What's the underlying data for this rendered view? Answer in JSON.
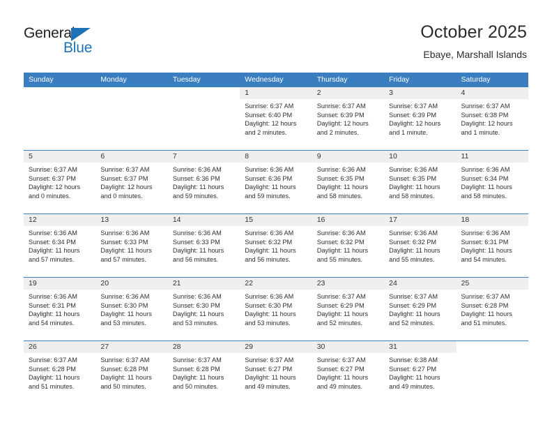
{
  "brand": {
    "name_top": "General",
    "name_bottom": "Blue",
    "accent_color": "#1f71b8"
  },
  "header": {
    "title": "October 2025",
    "subtitle": "Ebaye, Marshall Islands"
  },
  "theme": {
    "header_row_bg": "#3a7ebf",
    "day_band_bg": "#efefef",
    "grid_line": "#3a7ebf",
    "text": "#2e2e2e"
  },
  "weekdays": [
    "Sunday",
    "Monday",
    "Tuesday",
    "Wednesday",
    "Thursday",
    "Friday",
    "Saturday"
  ],
  "weeks": [
    [
      {
        "day": "",
        "blank": true
      },
      {
        "day": "",
        "blank": true
      },
      {
        "day": "",
        "blank": true
      },
      {
        "day": "1",
        "sunrise": "Sunrise: 6:37 AM",
        "sunset": "Sunset: 6:40 PM",
        "daylight1": "Daylight: 12 hours",
        "daylight2": "and 2 minutes."
      },
      {
        "day": "2",
        "sunrise": "Sunrise: 6:37 AM",
        "sunset": "Sunset: 6:39 PM",
        "daylight1": "Daylight: 12 hours",
        "daylight2": "and 2 minutes."
      },
      {
        "day": "3",
        "sunrise": "Sunrise: 6:37 AM",
        "sunset": "Sunset: 6:39 PM",
        "daylight1": "Daylight: 12 hours",
        "daylight2": "and 1 minute."
      },
      {
        "day": "4",
        "sunrise": "Sunrise: 6:37 AM",
        "sunset": "Sunset: 6:38 PM",
        "daylight1": "Daylight: 12 hours",
        "daylight2": "and 1 minute."
      }
    ],
    [
      {
        "day": "5",
        "sunrise": "Sunrise: 6:37 AM",
        "sunset": "Sunset: 6:37 PM",
        "daylight1": "Daylight: 12 hours",
        "daylight2": "and 0 minutes."
      },
      {
        "day": "6",
        "sunrise": "Sunrise: 6:37 AM",
        "sunset": "Sunset: 6:37 PM",
        "daylight1": "Daylight: 12 hours",
        "daylight2": "and 0 minutes."
      },
      {
        "day": "7",
        "sunrise": "Sunrise: 6:36 AM",
        "sunset": "Sunset: 6:36 PM",
        "daylight1": "Daylight: 11 hours",
        "daylight2": "and 59 minutes."
      },
      {
        "day": "8",
        "sunrise": "Sunrise: 6:36 AM",
        "sunset": "Sunset: 6:36 PM",
        "daylight1": "Daylight: 11 hours",
        "daylight2": "and 59 minutes."
      },
      {
        "day": "9",
        "sunrise": "Sunrise: 6:36 AM",
        "sunset": "Sunset: 6:35 PM",
        "daylight1": "Daylight: 11 hours",
        "daylight2": "and 58 minutes."
      },
      {
        "day": "10",
        "sunrise": "Sunrise: 6:36 AM",
        "sunset": "Sunset: 6:35 PM",
        "daylight1": "Daylight: 11 hours",
        "daylight2": "and 58 minutes."
      },
      {
        "day": "11",
        "sunrise": "Sunrise: 6:36 AM",
        "sunset": "Sunset: 6:34 PM",
        "daylight1": "Daylight: 11 hours",
        "daylight2": "and 58 minutes."
      }
    ],
    [
      {
        "day": "12",
        "sunrise": "Sunrise: 6:36 AM",
        "sunset": "Sunset: 6:34 PM",
        "daylight1": "Daylight: 11 hours",
        "daylight2": "and 57 minutes."
      },
      {
        "day": "13",
        "sunrise": "Sunrise: 6:36 AM",
        "sunset": "Sunset: 6:33 PM",
        "daylight1": "Daylight: 11 hours",
        "daylight2": "and 57 minutes."
      },
      {
        "day": "14",
        "sunrise": "Sunrise: 6:36 AM",
        "sunset": "Sunset: 6:33 PM",
        "daylight1": "Daylight: 11 hours",
        "daylight2": "and 56 minutes."
      },
      {
        "day": "15",
        "sunrise": "Sunrise: 6:36 AM",
        "sunset": "Sunset: 6:32 PM",
        "daylight1": "Daylight: 11 hours",
        "daylight2": "and 56 minutes."
      },
      {
        "day": "16",
        "sunrise": "Sunrise: 6:36 AM",
        "sunset": "Sunset: 6:32 PM",
        "daylight1": "Daylight: 11 hours",
        "daylight2": "and 55 minutes."
      },
      {
        "day": "17",
        "sunrise": "Sunrise: 6:36 AM",
        "sunset": "Sunset: 6:32 PM",
        "daylight1": "Daylight: 11 hours",
        "daylight2": "and 55 minutes."
      },
      {
        "day": "18",
        "sunrise": "Sunrise: 6:36 AM",
        "sunset": "Sunset: 6:31 PM",
        "daylight1": "Daylight: 11 hours",
        "daylight2": "and 54 minutes."
      }
    ],
    [
      {
        "day": "19",
        "sunrise": "Sunrise: 6:36 AM",
        "sunset": "Sunset: 6:31 PM",
        "daylight1": "Daylight: 11 hours",
        "daylight2": "and 54 minutes."
      },
      {
        "day": "20",
        "sunrise": "Sunrise: 6:36 AM",
        "sunset": "Sunset: 6:30 PM",
        "daylight1": "Daylight: 11 hours",
        "daylight2": "and 53 minutes."
      },
      {
        "day": "21",
        "sunrise": "Sunrise: 6:36 AM",
        "sunset": "Sunset: 6:30 PM",
        "daylight1": "Daylight: 11 hours",
        "daylight2": "and 53 minutes."
      },
      {
        "day": "22",
        "sunrise": "Sunrise: 6:36 AM",
        "sunset": "Sunset: 6:30 PM",
        "daylight1": "Daylight: 11 hours",
        "daylight2": "and 53 minutes."
      },
      {
        "day": "23",
        "sunrise": "Sunrise: 6:37 AM",
        "sunset": "Sunset: 6:29 PM",
        "daylight1": "Daylight: 11 hours",
        "daylight2": "and 52 minutes."
      },
      {
        "day": "24",
        "sunrise": "Sunrise: 6:37 AM",
        "sunset": "Sunset: 6:29 PM",
        "daylight1": "Daylight: 11 hours",
        "daylight2": "and 52 minutes."
      },
      {
        "day": "25",
        "sunrise": "Sunrise: 6:37 AM",
        "sunset": "Sunset: 6:28 PM",
        "daylight1": "Daylight: 11 hours",
        "daylight2": "and 51 minutes."
      }
    ],
    [
      {
        "day": "26",
        "sunrise": "Sunrise: 6:37 AM",
        "sunset": "Sunset: 6:28 PM",
        "daylight1": "Daylight: 11 hours",
        "daylight2": "and 51 minutes."
      },
      {
        "day": "27",
        "sunrise": "Sunrise: 6:37 AM",
        "sunset": "Sunset: 6:28 PM",
        "daylight1": "Daylight: 11 hours",
        "daylight2": "and 50 minutes."
      },
      {
        "day": "28",
        "sunrise": "Sunrise: 6:37 AM",
        "sunset": "Sunset: 6:28 PM",
        "daylight1": "Daylight: 11 hours",
        "daylight2": "and 50 minutes."
      },
      {
        "day": "29",
        "sunrise": "Sunrise: 6:37 AM",
        "sunset": "Sunset: 6:27 PM",
        "daylight1": "Daylight: 11 hours",
        "daylight2": "and 49 minutes."
      },
      {
        "day": "30",
        "sunrise": "Sunrise: 6:37 AM",
        "sunset": "Sunset: 6:27 PM",
        "daylight1": "Daylight: 11 hours",
        "daylight2": "and 49 minutes."
      },
      {
        "day": "31",
        "sunrise": "Sunrise: 6:38 AM",
        "sunset": "Sunset: 6:27 PM",
        "daylight1": "Daylight: 11 hours",
        "daylight2": "and 49 minutes."
      },
      {
        "day": "",
        "blank": true
      }
    ]
  ]
}
